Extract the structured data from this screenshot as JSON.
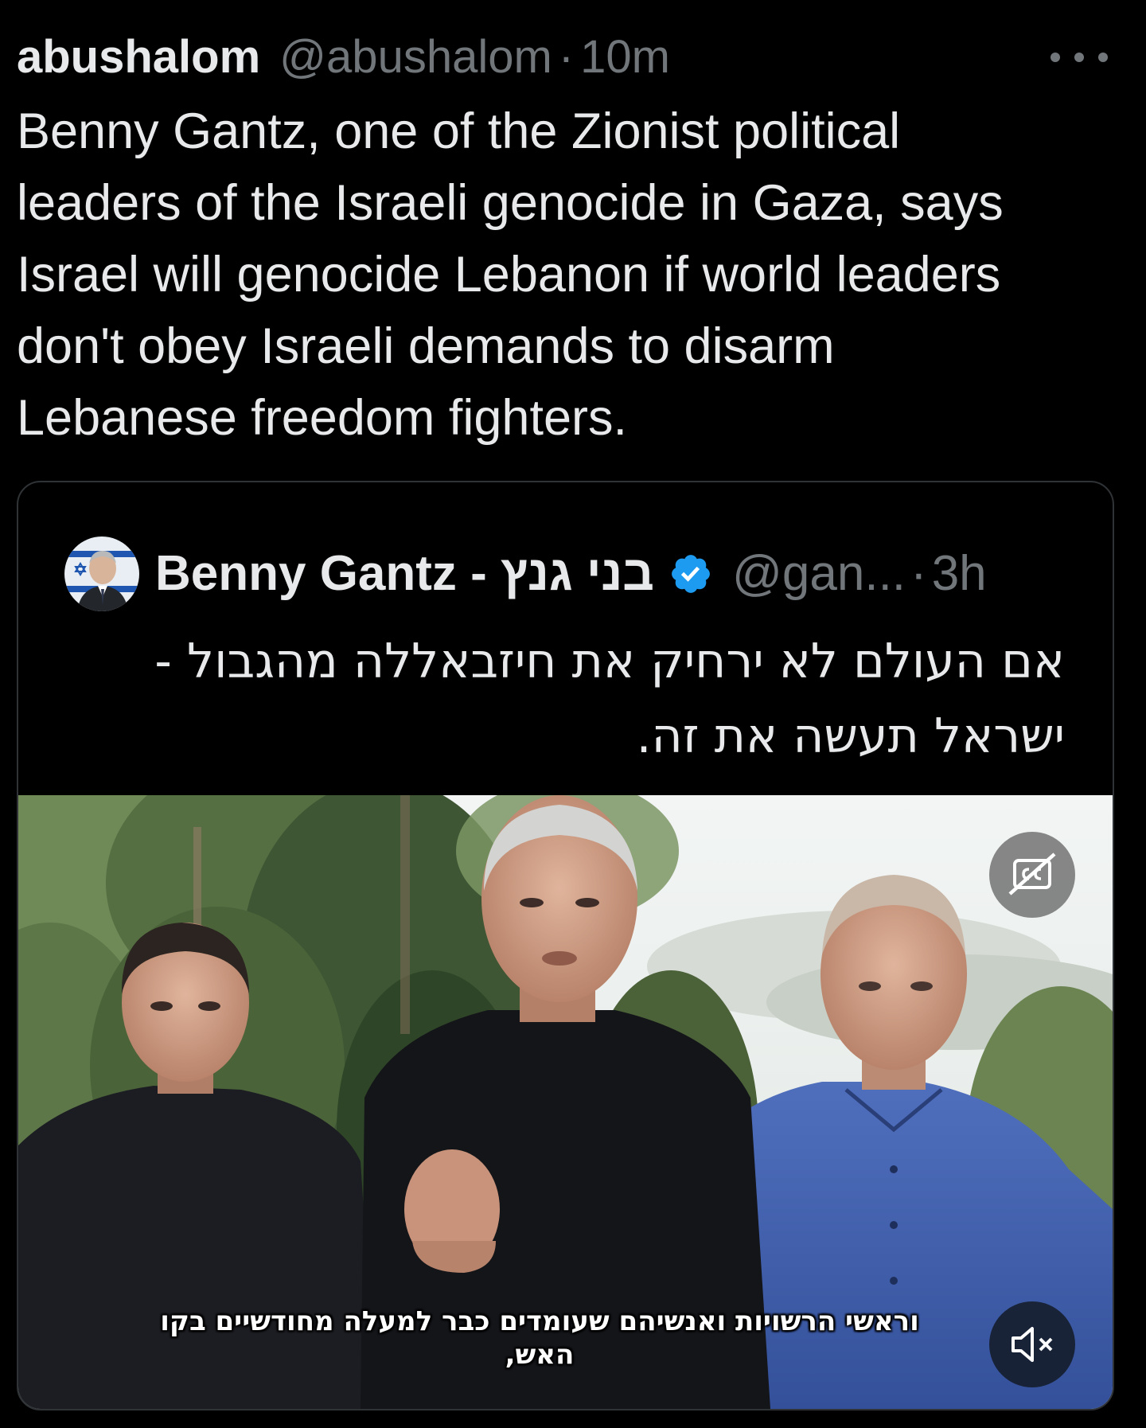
{
  "tweet": {
    "display_name": "abushalom",
    "handle": "@abushalom",
    "separator": "·",
    "time": "10m",
    "more_icon": "more-horizontal-icon",
    "text": "Benny Gantz, one of the Zionist political\nleaders of the Israeli genocide in Gaza, says\nIsrael will genocide Lebanon if world leaders\ndon't obey Israeli demands to disarm\nLebanese freedom fighters."
  },
  "quote": {
    "display_name": "Benny Gantz - בני גנץ",
    "verified_icon": "verified-badge-icon",
    "handle": "@gan...",
    "separator": "·",
    "time": "3h",
    "text": "אם העולם לא ירחיק את חיזבאללה מהגבול -\nישראל תעשה את זה.",
    "video": {
      "captions_icon": "captions-off-icon",
      "mute_icon": "volume-muted-icon",
      "subtitle": "וראשי הרשויות ואנשיהם שעומדים כבר למעלה מחודשיים בקו\nהאש,"
    }
  },
  "colors": {
    "background": "#000000",
    "text_primary": "#e7e9ea",
    "text_secondary": "#71767b",
    "border": "#2f3336",
    "verified": "#1d9bf0"
  }
}
